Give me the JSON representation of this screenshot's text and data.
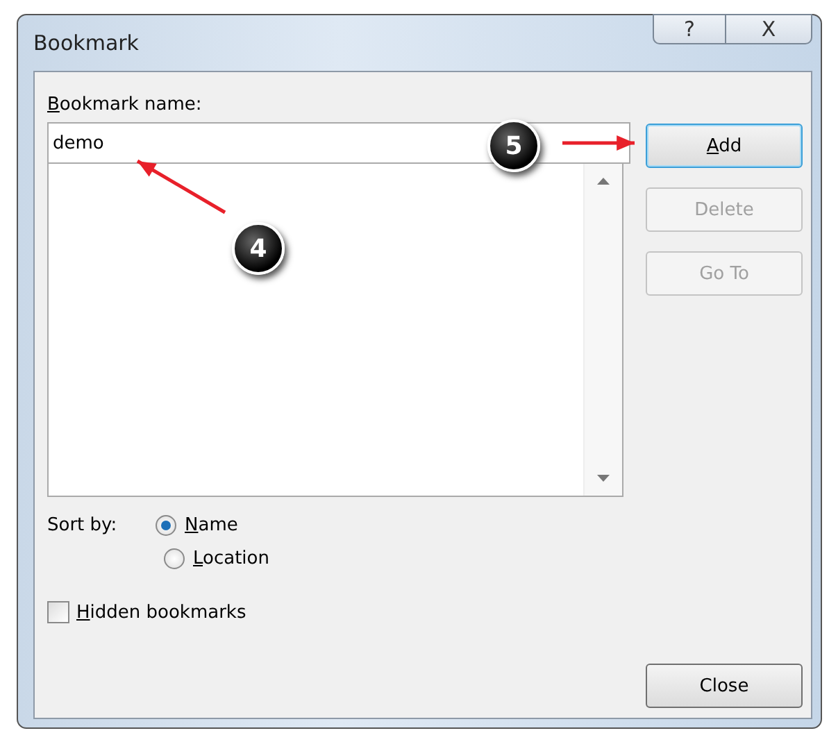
{
  "window": {
    "title": "Bookmark",
    "title_buttons": [
      {
        "kind": "help",
        "label": "?"
      },
      {
        "kind": "close",
        "label": "X"
      }
    ]
  },
  "name_field": {
    "access_key": "B",
    "label_rest": "ookmark name:",
    "value": "demo"
  },
  "buttons": [
    {
      "access_key": "A",
      "label_rest": "dd",
      "disabled": false,
      "focused": true
    },
    {
      "label_rest": "Delete",
      "disabled": true,
      "focused": false
    },
    {
      "label_rest": "Go To",
      "disabled": true,
      "focused": false
    }
  ],
  "sort": {
    "label": "Sort by:",
    "options": [
      {
        "access_key": "N",
        "label_rest": "ame",
        "selected": true
      },
      {
        "access_key": "L",
        "label_rest": "ocation",
        "selected": false
      }
    ]
  },
  "hidden_bookmarks": {
    "access_key": "H",
    "label_rest": "idden bookmarks",
    "checked": false
  },
  "close_button": {
    "label": "Close"
  },
  "annotations": [
    {
      "number": "4"
    },
    {
      "number": "5"
    }
  ]
}
